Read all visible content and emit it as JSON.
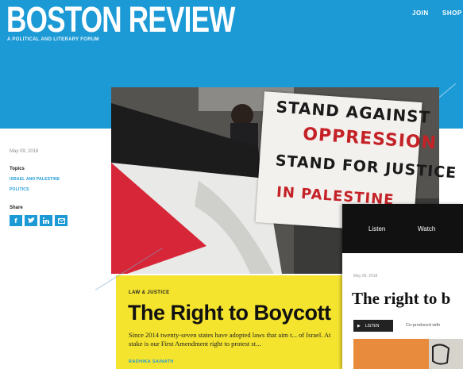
{
  "header": {
    "logo": "BOSTON REVIEW",
    "tagline": "A POLITICAL AND LITERARY FORUM",
    "nav": {
      "join": "JOIN",
      "shop": "SHOP"
    },
    "color": "#1c9ad6"
  },
  "sidebar": {
    "date": "May 09, 2018",
    "topics_label": "Topics",
    "topics": [
      "ISRAEL AND PALESTINE",
      "POLITICS"
    ],
    "share_label": "Share",
    "share_icons": [
      "facebook-icon",
      "twitter-icon",
      "linkedin-icon",
      "email-icon"
    ]
  },
  "photo": {
    "banner_lines": [
      "STAND AGAINST",
      "OPPRESSION",
      "STAND FOR JUSTICE",
      "IN PALESTINE"
    ]
  },
  "article": {
    "kicker": "LAW & JUSTICE",
    "title": "The Right to Boycott",
    "excerpt": "Since 2014 twenty-seven states have adopted laws that aim t... of Israel. At stake is our First Amendment right to protest st...",
    "byline": "RADHIKA SAINATH",
    "card_color": "#f5e42e"
  },
  "player": {
    "tabs": [
      "Listen",
      "Watch"
    ],
    "date": "May 09, 2018",
    "title": "The right to b",
    "listen_label": "LISTEN",
    "coauthor": "Co-produced with"
  }
}
